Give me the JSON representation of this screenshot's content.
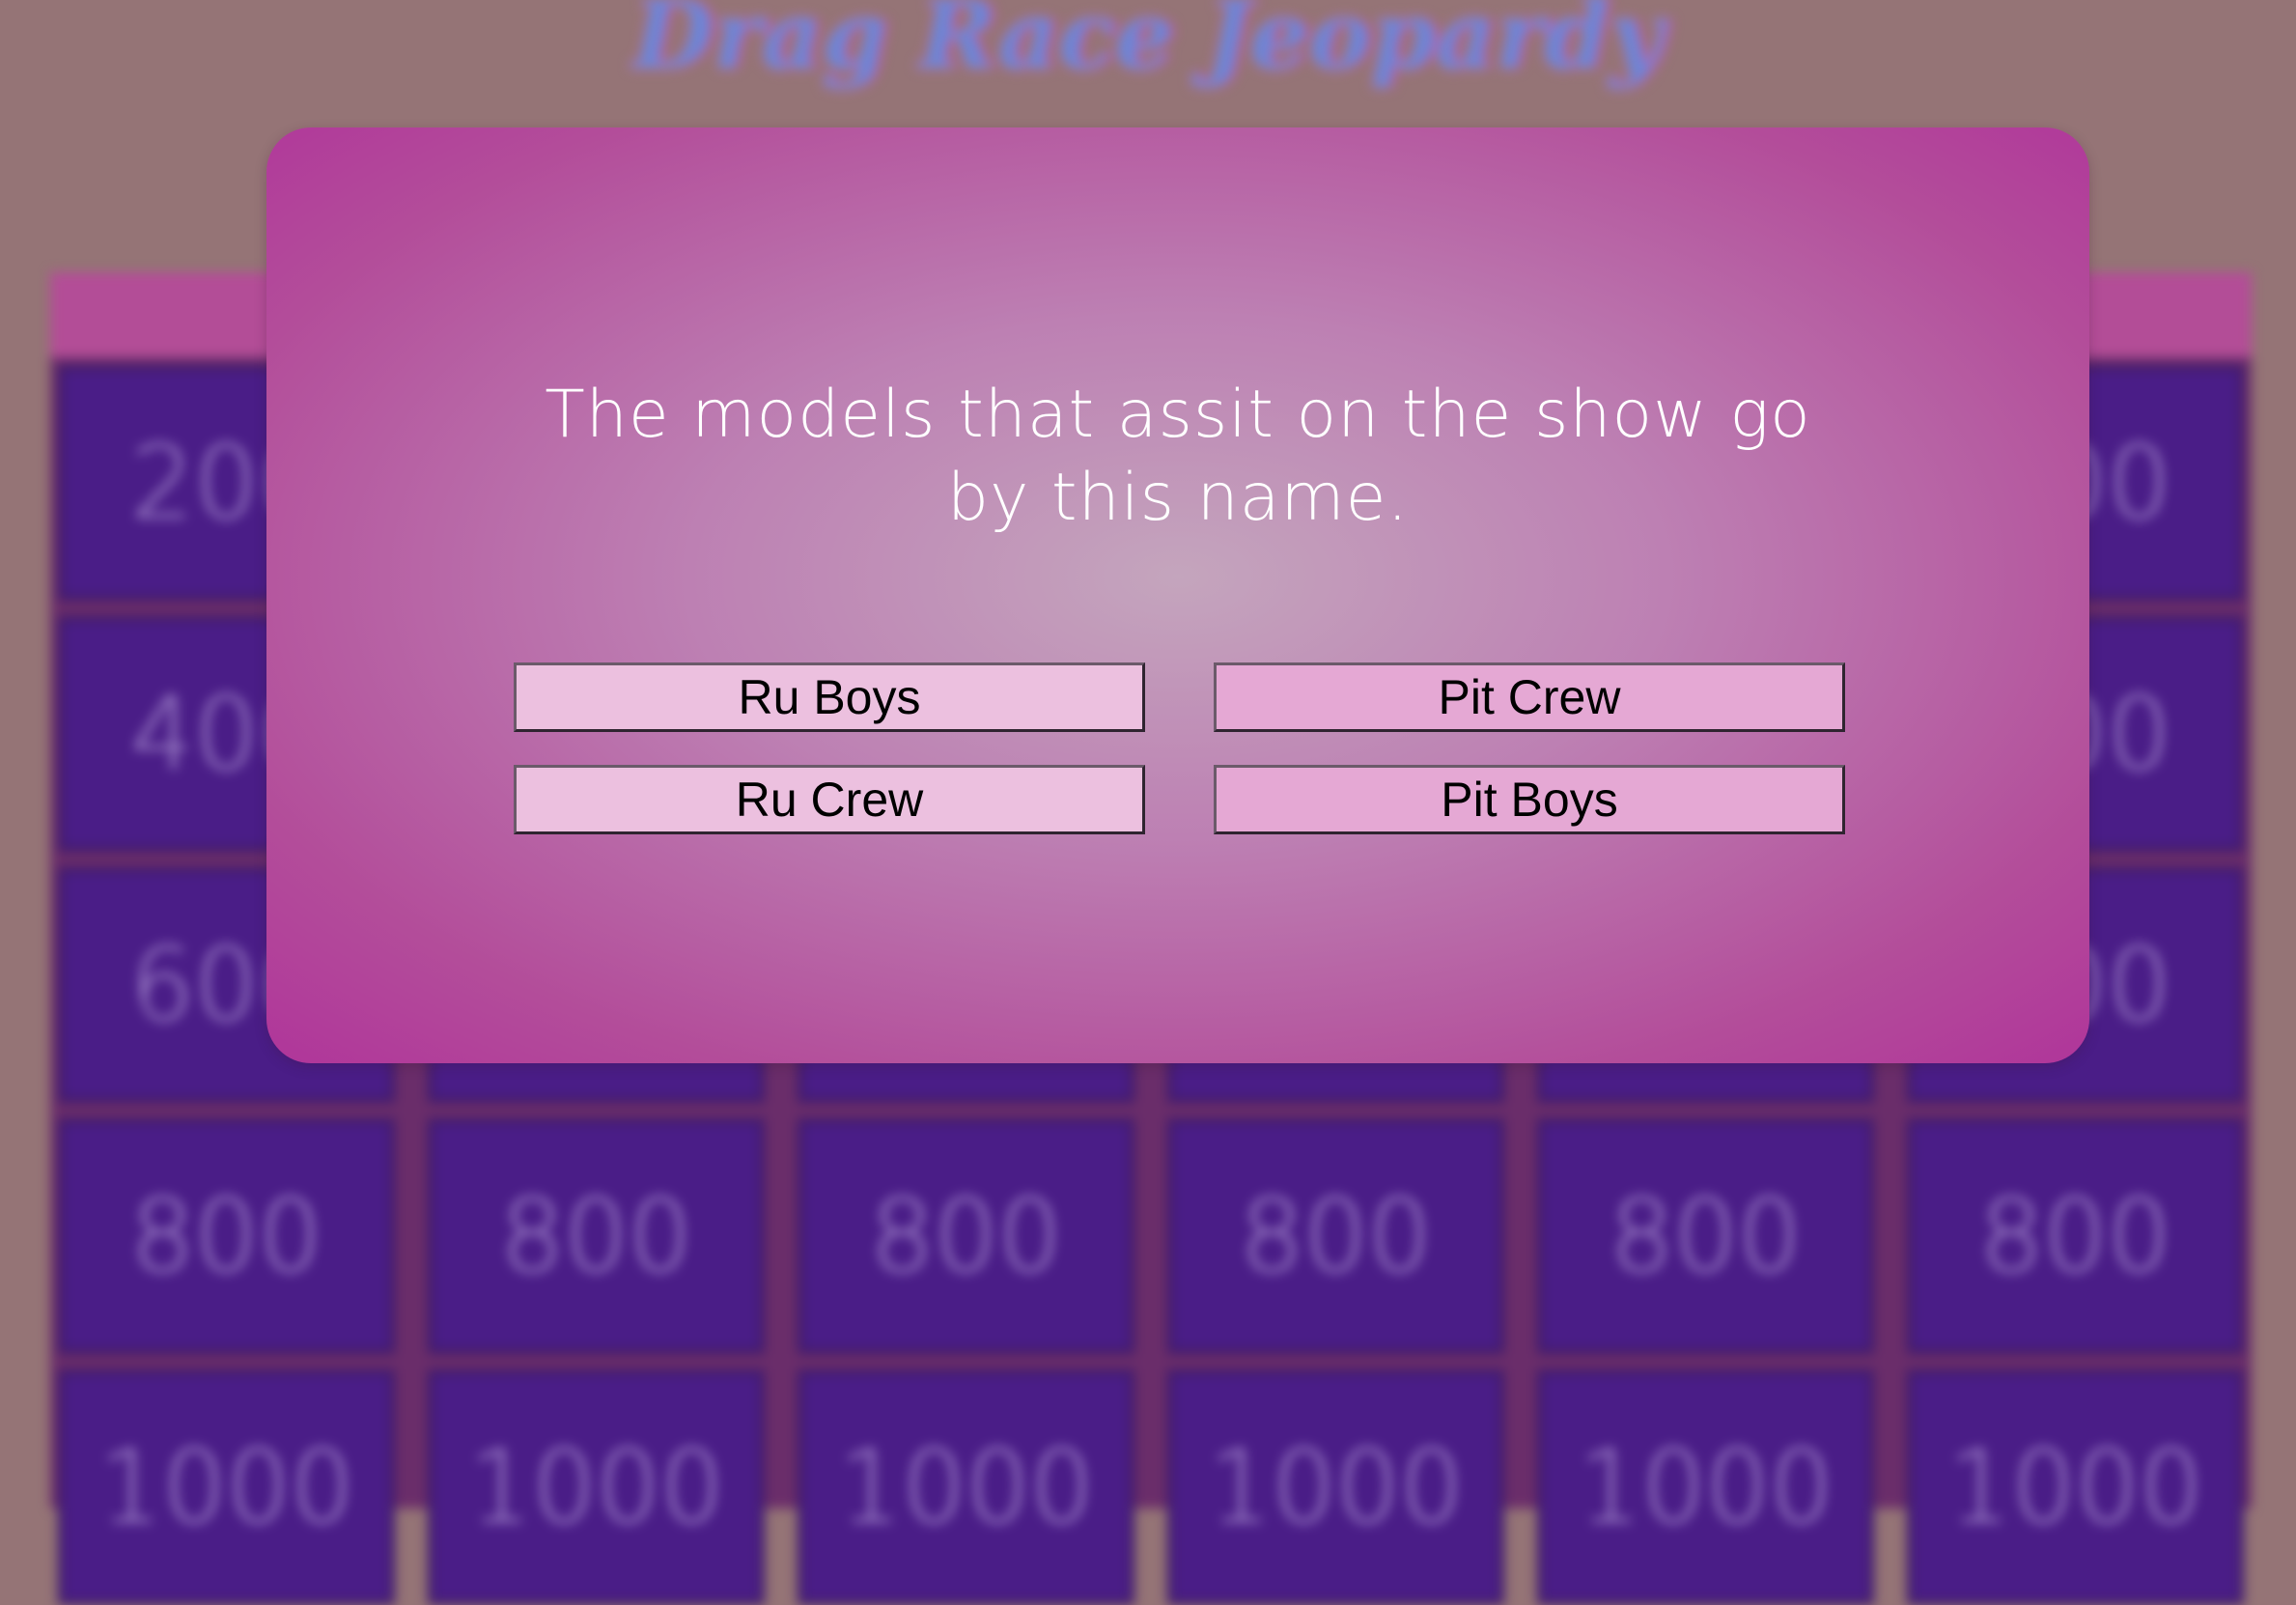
{
  "game": {
    "title": "Drag Race Jeopardy"
  },
  "board": {
    "tile_values": [
      "200",
      "400",
      "600",
      "800",
      "1000"
    ],
    "columns": 6
  },
  "modal": {
    "question": "The models that assit on the show go by this name.",
    "answers": [
      "Ru Boys",
      "Pit Crew",
      "Ru Crew",
      "Pit Boys"
    ]
  },
  "colors": {
    "page_background": "#957476",
    "tile": "#4a1d87",
    "modal_center": "#c4a5bd",
    "modal_edge": "#b0359a",
    "answer_left": "#ecc0df",
    "answer_right": "#e5a8d4"
  }
}
